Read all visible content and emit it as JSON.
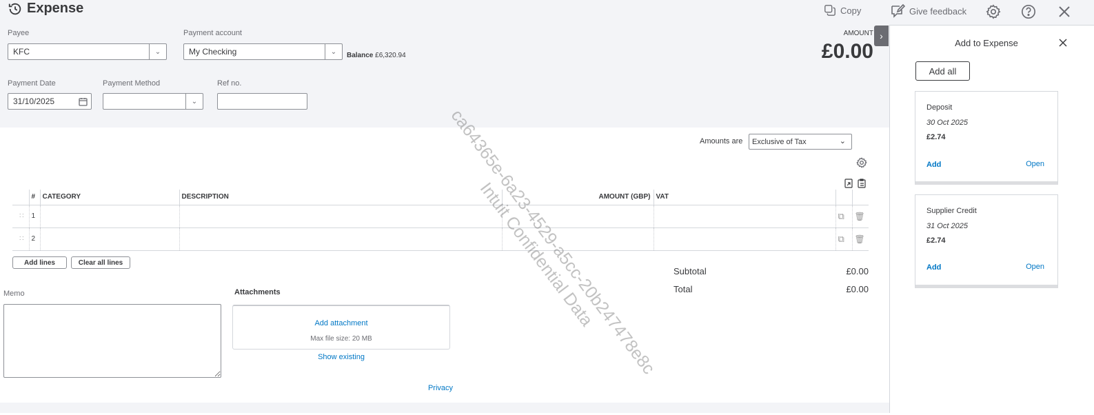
{
  "header": {
    "title": "Expense",
    "copy": "Copy",
    "feedback": "Give feedback"
  },
  "form": {
    "payee_label": "Payee",
    "payee_value": "KFC",
    "account_label": "Payment account",
    "account_value": "My Checking",
    "balance_label": "Balance",
    "balance_value": "£6,320.94",
    "date_label": "Payment Date",
    "date_value": "31/10/2025",
    "method_label": "Payment Method",
    "method_value": "",
    "ref_label": "Ref no.",
    "ref_value": "",
    "amount_label": "AMOUNT",
    "amount_value": "£0.00"
  },
  "amounts_are": {
    "label": "Amounts are",
    "value": "Exclusive of Tax"
  },
  "table": {
    "headers": [
      "#",
      "CATEGORY",
      "DESCRIPTION",
      "AMOUNT (GBP)",
      "VAT"
    ],
    "rows": [
      "1",
      "2"
    ],
    "add_lines": "Add lines",
    "clear_lines": "Clear all lines"
  },
  "totals": {
    "subtotal_label": "Subtotal",
    "subtotal": "£0.00",
    "total_label": "Total",
    "total": "£0.00"
  },
  "memo": {
    "label": "Memo"
  },
  "attachments": {
    "label": "Attachments",
    "add": "Add attachment",
    "max": "Max file size: 20 MB",
    "show_existing": "Show existing"
  },
  "privacy": "Privacy",
  "panel": {
    "title": "Add to Expense",
    "add_all": "Add all",
    "cards": [
      {
        "type": "Deposit",
        "date": "30 Oct 2025",
        "amount": "£2.74",
        "add": "Add",
        "open": "Open"
      },
      {
        "type": "Supplier Credit",
        "date": "31 Oct 2025",
        "amount": "£2.74",
        "add": "Add",
        "open": "Open"
      }
    ]
  },
  "watermark": {
    "line1": "ca64365e-6a23-4529-a5cc-20b247478e8c",
    "line2": "Intuit Confidential Data"
  }
}
